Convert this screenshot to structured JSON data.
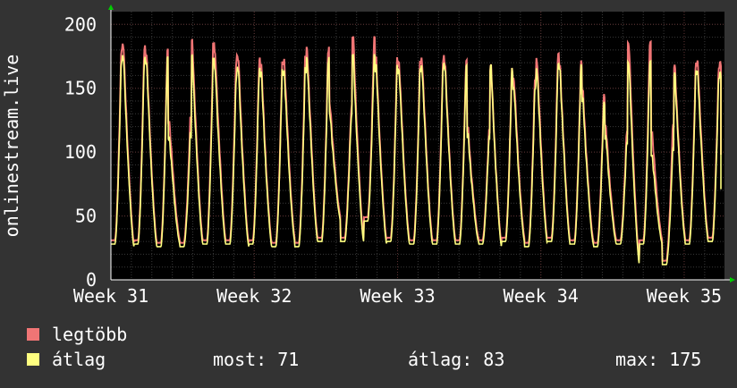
{
  "chart_data": {
    "type": "line",
    "ylabel": "onlinestream.live",
    "ylim": [
      0,
      210
    ],
    "yticks": [
      0,
      50,
      100,
      150,
      200
    ],
    "x_ticks": [
      {
        "label": "Week 31",
        "pos": 0.0
      },
      {
        "label": "Week 32",
        "pos": 0.2336
      },
      {
        "label": "Week 33",
        "pos": 0.4672
      },
      {
        "label": "Week 34",
        "pos": 0.7007
      },
      {
        "label": "Week 35",
        "pos": 0.9343
      }
    ],
    "grid": true,
    "peaks": [
      {
        "avg": 174,
        "max": 183,
        "min": 28
      },
      {
        "avg": 172,
        "max": 178,
        "min": 26
      },
      {
        "avg": 112,
        "max": 124,
        "min": 26
      },
      {
        "avg": 174,
        "max": 186,
        "min": 28
      },
      {
        "avg": 162,
        "max": 175,
        "min": 28
      },
      {
        "avg": 165,
        "max": 173,
        "min": 28
      },
      {
        "avg": 162,
        "max": 168,
        "min": 26
      },
      {
        "avg": 163,
        "max": 172,
        "min": 26
      },
      {
        "avg": 172,
        "max": 180,
        "min": 30
      },
      {
        "avg": 128,
        "max": 135,
        "min": 30
      },
      {
        "avg": 176,
        "max": 190,
        "min": 46
      },
      {
        "avg": 166,
        "max": 172,
        "min": 30
      },
      {
        "avg": 164,
        "max": 170,
        "min": 28
      },
      {
        "avg": 166,
        "max": 172,
        "min": 28
      },
      {
        "avg": 166,
        "max": 170,
        "min": 28
      },
      {
        "avg": 112,
        "max": 117,
        "min": 28
      },
      {
        "avg": 166,
        "max": 166,
        "min": 30
      },
      {
        "avg": 150,
        "max": 157,
        "min": 26
      },
      {
        "avg": 166,
        "max": 174,
        "min": 30
      },
      {
        "avg": 166,
        "max": 169,
        "min": 28
      },
      {
        "avg": 140,
        "max": 146,
        "min": 26
      },
      {
        "avg": 110,
        "max": 118,
        "min": 28
      },
      {
        "avg": 170,
        "max": 185,
        "min": 28
      },
      {
        "avg": 100,
        "max": 118,
        "min": 12
      },
      {
        "avg": 162,
        "max": 168,
        "min": 28
      },
      {
        "avg": 160,
        "max": 168,
        "min": 30
      }
    ],
    "last_max": 98,
    "last_avg": 71,
    "series": [
      {
        "name": "legtöbb",
        "color": "#f07575"
      },
      {
        "name": "átlag",
        "color": "#ffff80"
      }
    ]
  },
  "legend": {
    "max_label": "legtöbb",
    "avg_label": "átlag",
    "max_color": "#f07575",
    "avg_color": "#ffff80"
  },
  "stats": {
    "now": "most: 71",
    "avg": "átlag: 83",
    "max": "max: 175"
  }
}
